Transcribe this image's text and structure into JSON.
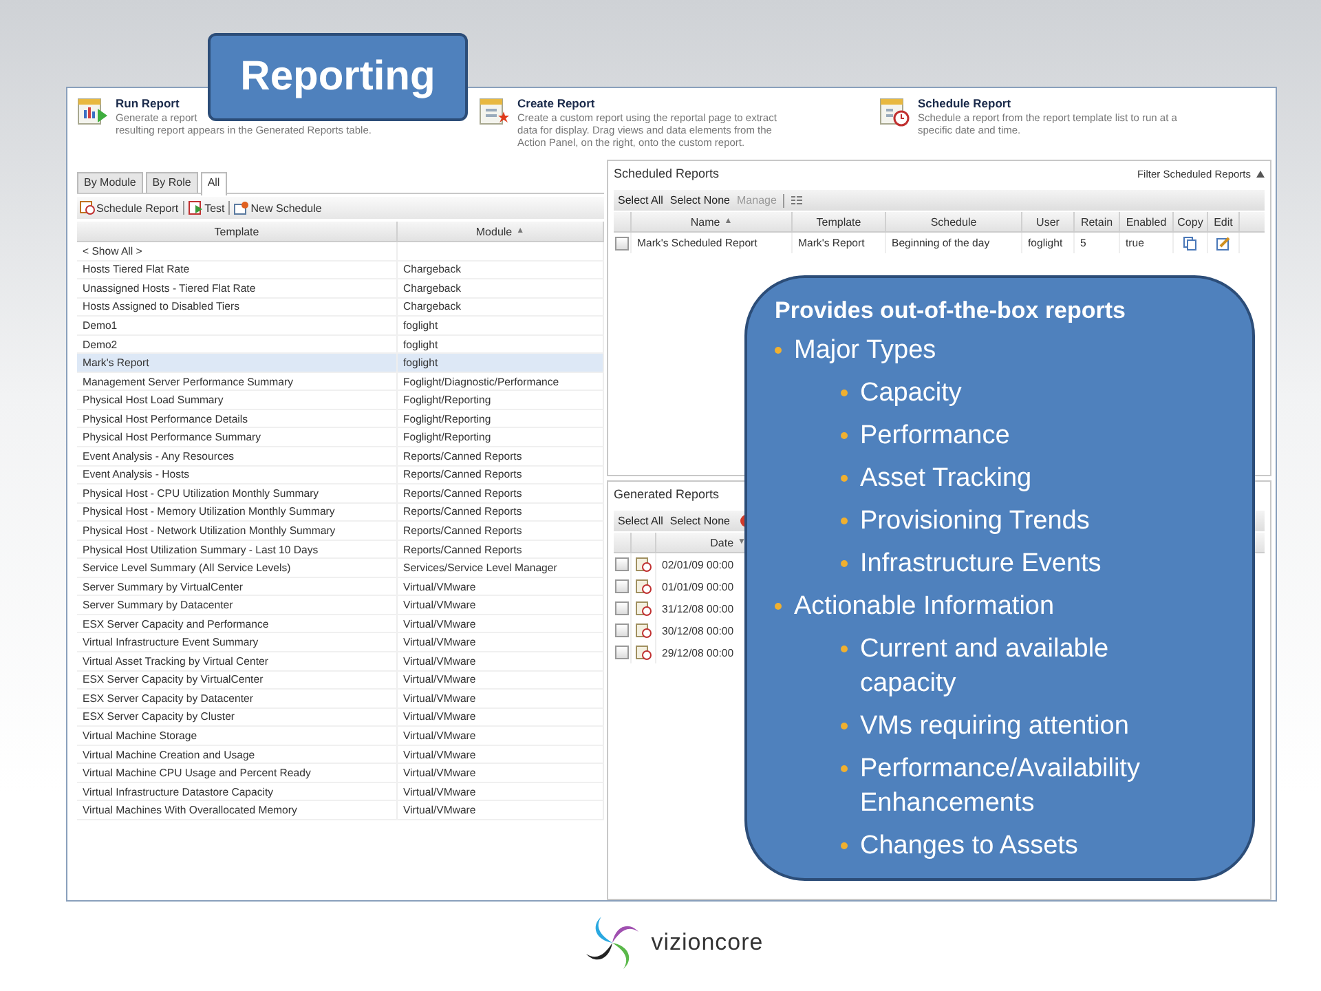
{
  "slide_title": "Reporting",
  "actions": [
    {
      "kind": "run",
      "title": "Run Report",
      "lines": [
        "Generate a report",
        "resulting report appears in the Generated Reports table."
      ]
    },
    {
      "kind": "create",
      "title": "Create Report",
      "lines": [
        "Create a custom report using the reportal page to extract",
        "data for display. Drag views and data elements from the",
        "Action Panel, on the right, onto the custom report."
      ]
    },
    {
      "kind": "schedule",
      "title": "Schedule Report",
      "lines": [
        "Schedule a report from the report template list to run at a",
        "specific date and time."
      ]
    }
  ],
  "tabs": [
    {
      "label": "By Module",
      "selected": false
    },
    {
      "label": "By Role",
      "selected": false
    },
    {
      "label": "All",
      "selected": true
    }
  ],
  "template_toolbar": [
    {
      "kind": "schedule",
      "label": "Schedule Report"
    },
    {
      "kind": "test",
      "label": "Test"
    },
    {
      "kind": "new",
      "label": "New Schedule"
    }
  ],
  "templates": {
    "columns": [
      {
        "label": "Template"
      },
      {
        "label": "Module",
        "sort": "▲"
      }
    ],
    "rows": [
      {
        "template": "< Show All >",
        "module": "",
        "selected": false
      },
      {
        "template": "Hosts Tiered Flat Rate",
        "module": "Chargeback",
        "selected": false
      },
      {
        "template": "Unassigned Hosts - Tiered Flat Rate",
        "module": "Chargeback",
        "selected": false
      },
      {
        "template": "Hosts Assigned to Disabled Tiers",
        "module": "Chargeback",
        "selected": false
      },
      {
        "template": "Demo1",
        "module": "foglight",
        "selected": false
      },
      {
        "template": "Demo2",
        "module": "foglight",
        "selected": false
      },
      {
        "template": "Mark's Report",
        "module": "foglight",
        "selected": true
      },
      {
        "template": "Management Server Performance Summary",
        "module": "Foglight/Diagnostic/Performance",
        "selected": false
      },
      {
        "template": "Physical Host Load Summary",
        "module": "Foglight/Reporting",
        "selected": false
      },
      {
        "template": "Physical Host Performance Details",
        "module": "Foglight/Reporting",
        "selected": false
      },
      {
        "template": "Physical Host Performance Summary",
        "module": "Foglight/Reporting",
        "selected": false
      },
      {
        "template": "Event Analysis - Any Resources",
        "module": "Reports/Canned Reports",
        "selected": false
      },
      {
        "template": "Event Analysis - Hosts",
        "module": "Reports/Canned Reports",
        "selected": false
      },
      {
        "template": "Physical Host - CPU Utilization Monthly Summary",
        "module": "Reports/Canned Reports",
        "selected": false
      },
      {
        "template": "Physical Host - Memory Utilization Monthly Summary",
        "module": "Reports/Canned Reports",
        "selected": false
      },
      {
        "template": "Physical Host - Network Utilization Monthly Summary",
        "module": "Reports/Canned Reports",
        "selected": false
      },
      {
        "template": "Physical Host Utilization Summary - Last 10 Days",
        "module": "Reports/Canned Reports",
        "selected": false
      },
      {
        "template": "Service Level Summary (All Service Levels)",
        "module": "Services/Service Level Manager",
        "selected": false
      },
      {
        "template": "Server Summary by VirtualCenter",
        "module": "Virtual/VMware",
        "selected": false
      },
      {
        "template": "Server Summary by Datacenter",
        "module": "Virtual/VMware",
        "selected": false
      },
      {
        "template": "ESX Server Capacity and Performance",
        "module": "Virtual/VMware",
        "selected": false
      },
      {
        "template": "Virtual Infrastructure Event Summary",
        "module": "Virtual/VMware",
        "selected": false
      },
      {
        "template": "Virtual Asset Tracking by Virtual Center",
        "module": "Virtual/VMware",
        "selected": false
      },
      {
        "template": "ESX Server Capacity by VirtualCenter",
        "module": "Virtual/VMware",
        "selected": false
      },
      {
        "template": "ESX Server Capacity by Datacenter",
        "module": "Virtual/VMware",
        "selected": false
      },
      {
        "template": "ESX Server Capacity by Cluster",
        "module": "Virtual/VMware",
        "selected": false
      },
      {
        "template": "Virtual Machine Storage",
        "module": "Virtual/VMware",
        "selected": false
      },
      {
        "template": "Virtual Machine Creation and Usage",
        "module": "Virtual/VMware",
        "selected": false
      },
      {
        "template": "Virtual Machine CPU Usage and Percent Ready",
        "module": "Virtual/VMware",
        "selected": false
      },
      {
        "template": "Virtual Infrastructure Datastore Capacity",
        "module": "Virtual/VMware",
        "selected": false
      },
      {
        "template": "Virtual Machines With Overallocated Memory",
        "module": "Virtual/VMware",
        "selected": false
      }
    ]
  },
  "scheduled": {
    "title": "Scheduled Reports",
    "filter": "Filter Scheduled Reports",
    "toolbar": [
      {
        "label": "Select All",
        "disabled": false
      },
      {
        "label": "Select None",
        "disabled": false
      },
      {
        "label": "Manage",
        "disabled": true
      }
    ],
    "columns": [
      {
        "label": "Name",
        "sort": "▲"
      },
      {
        "label": "Template"
      },
      {
        "label": "Schedule"
      },
      {
        "label": "User"
      },
      {
        "label": "Retain"
      },
      {
        "label": "Enabled"
      },
      {
        "label": "Copy"
      },
      {
        "label": "Edit"
      }
    ],
    "rows": [
      {
        "checked": false,
        "name": "Mark's Scheduled Report",
        "template": "Mark's Report",
        "schedule": "Beginning of the day",
        "user": "foglight",
        "retain": "5",
        "enabled": "true"
      }
    ]
  },
  "generated": {
    "title": "Generated Reports",
    "toolbar": [
      {
        "label": "Select All"
      },
      {
        "label": "Select None"
      }
    ],
    "columns": [
      {
        "label": "Date",
        "sort": "▼"
      }
    ],
    "rows": [
      {
        "checked": false,
        "date": "02/01/09 00:00"
      },
      {
        "checked": false,
        "date": "01/01/09 00:00"
      },
      {
        "checked": false,
        "date": "31/12/08 00:00"
      },
      {
        "checked": false,
        "date": "30/12/08 00:00"
      },
      {
        "checked": false,
        "date": "29/12/08 00:00"
      }
    ]
  },
  "callout": {
    "heading": "Provides out-of-the-box reports",
    "items": [
      {
        "text": "Major Types",
        "children": [
          {
            "text": "Capacity"
          },
          {
            "text": "Performance"
          },
          {
            "text": "Asset Tracking"
          },
          {
            "text": "Provisioning Trends"
          },
          {
            "text": "Infrastructure Events"
          }
        ]
      },
      {
        "text": "Actionable Information",
        "children": [
          {
            "text": "Current and available capacity"
          },
          {
            "text": "VMs requiring attention"
          },
          {
            "text": "Performance/Availability Enhancements"
          },
          {
            "text": "Changes to Assets"
          }
        ]
      }
    ]
  },
  "logo": {
    "name": "vizioncore"
  }
}
